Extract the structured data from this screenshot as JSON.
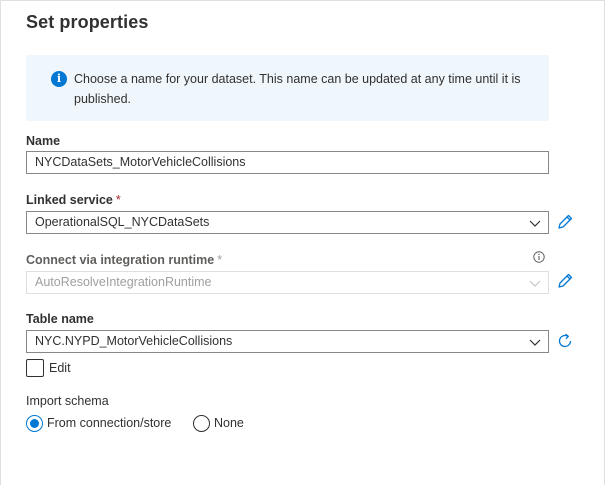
{
  "panel": {
    "title": "Set properties",
    "info_message": "Choose a name for your dataset. This name can be updated at any time until it is published."
  },
  "fields": {
    "name": {
      "label": "Name",
      "value": "NYCDataSets_MotorVehicleCollisions"
    },
    "linked_service": {
      "label": "Linked service",
      "required_mark": "*",
      "value": "OperationalSQL_NYCDataSets",
      "icon": "edit-pencil-icon"
    },
    "integration_runtime": {
      "label": "Connect via integration runtime",
      "required_mark": "*",
      "value": "AutoResolveIntegrationRuntime",
      "disabled": true,
      "icon": "edit-pencil-icon"
    },
    "table_name": {
      "label": "Table name",
      "value": "NYC.NYPD_MotorVehicleCollisions",
      "icon": "refresh-icon"
    }
  },
  "edit_checkbox": {
    "label": "Edit",
    "checked": false
  },
  "import_schema": {
    "label": "Import schema",
    "options": [
      {
        "label": "From connection/store",
        "selected": true
      },
      {
        "label": "None",
        "selected": false
      }
    ]
  },
  "colors": {
    "accent": "#0078d4",
    "info_background": "#eff6fc",
    "required": "#a4262c"
  }
}
